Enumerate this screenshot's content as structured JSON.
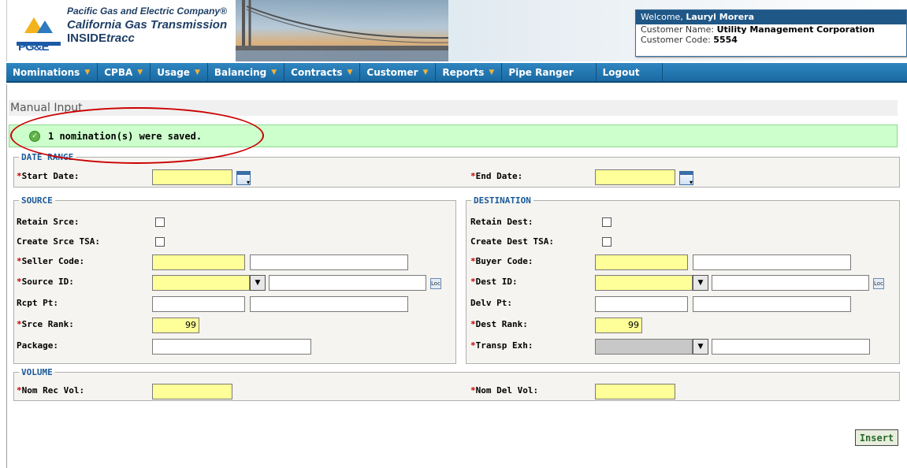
{
  "header": {
    "company_line1": "Pacific Gas and Electric Company®",
    "company_line2": "California Gas Transmission",
    "company_line3a": "INSIDE",
    "company_line3b": "tracc",
    "logo_text": "PG&E"
  },
  "welcome": {
    "welcome_label": "Welcome,",
    "user_name": "Lauryl Morera",
    "customer_name_label": "Customer Name:",
    "customer_name": "Utility Management Corporation",
    "customer_code_label": "Customer Code:",
    "customer_code": "5554"
  },
  "nav": {
    "items": [
      {
        "label": "Nominations",
        "dropdown": true
      },
      {
        "label": "CPBA",
        "dropdown": true
      },
      {
        "label": "Usage",
        "dropdown": true
      },
      {
        "label": "Balancing",
        "dropdown": true
      },
      {
        "label": "Contracts",
        "dropdown": true
      },
      {
        "label": "Customer",
        "dropdown": true
      },
      {
        "label": "Reports",
        "dropdown": true
      },
      {
        "label": "Pipe Ranger",
        "dropdown": false
      },
      {
        "label": "Logout",
        "dropdown": false
      }
    ]
  },
  "page": {
    "title": "Manual Input",
    "message": "1 nomination(s) were saved."
  },
  "date_range": {
    "legend": "DATE RANGE",
    "start_label": "Start Date:",
    "start_value": "",
    "end_label": "End Date:",
    "end_value": ""
  },
  "source": {
    "legend": "SOURCE",
    "retain_label": "Retain Srce:",
    "create_tsa_label": "Create Srce TSA:",
    "seller_code_label": "Seller Code:",
    "source_id_label": "Source ID:",
    "rcpt_pt_label": "Rcpt Pt:",
    "rank_label": "Srce Rank:",
    "rank_value": "99",
    "package_label": "Package:"
  },
  "destination": {
    "legend": "DESTINATION",
    "retain_label": "Retain Dest:",
    "create_tsa_label": "Create Dest TSA:",
    "buyer_code_label": "Buyer Code:",
    "dest_id_label": "Dest ID:",
    "delv_pt_label": "Delv Pt:",
    "rank_label": "Dest Rank:",
    "rank_value": "99",
    "transp_exh_label": "Transp Exh:"
  },
  "volume": {
    "legend": "VOLUME",
    "rec_label": "Nom Rec Vol:",
    "del_label": "Nom Del Vol:"
  },
  "actions": {
    "insert_label": "Insert"
  },
  "loc_icon_text": "Loc",
  "required_marker": "*",
  "colors": {
    "nav_bg": "#1a6aa3",
    "required_field": "#ffff99",
    "success_bg": "#ccffcc",
    "legend": "#1a5a9a",
    "annotation_circle": "#cc0000"
  }
}
